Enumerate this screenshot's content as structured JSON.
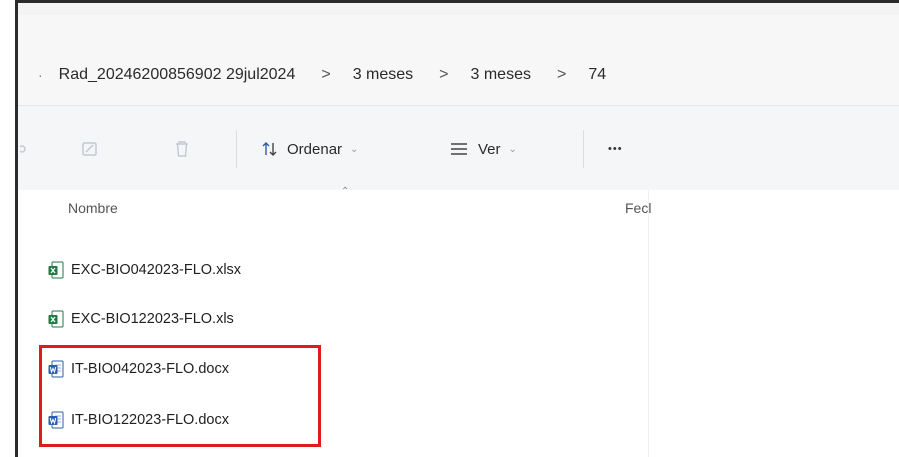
{
  "breadcrumb": {
    "lead": "·",
    "items": [
      "Rad_20246200856902 29jul2024",
      "3 meses",
      "3 meses",
      "74"
    ],
    "separator": ">"
  },
  "toolbar": {
    "sort_label": "Ordenar",
    "view_label": "Ver",
    "more_label": "•••",
    "caret": "⌄"
  },
  "columns": {
    "name": "Nombre",
    "date": "Fecl"
  },
  "files": [
    {
      "name": "EXC-BIO042023-FLO.xlsx",
      "icon": "excel-icon"
    },
    {
      "name": "EXC-BIO122023-FLO.xls",
      "icon": "excel-icon"
    },
    {
      "name": "IT-BIO042023-FLO.docx",
      "icon": "word-icon"
    },
    {
      "name": "IT-BIO122023-FLO.docx",
      "icon": "word-icon"
    }
  ],
  "colors": {
    "highlight": "#e01b1b",
    "excel": "#1d7a43",
    "word": "#2b5eaa"
  }
}
